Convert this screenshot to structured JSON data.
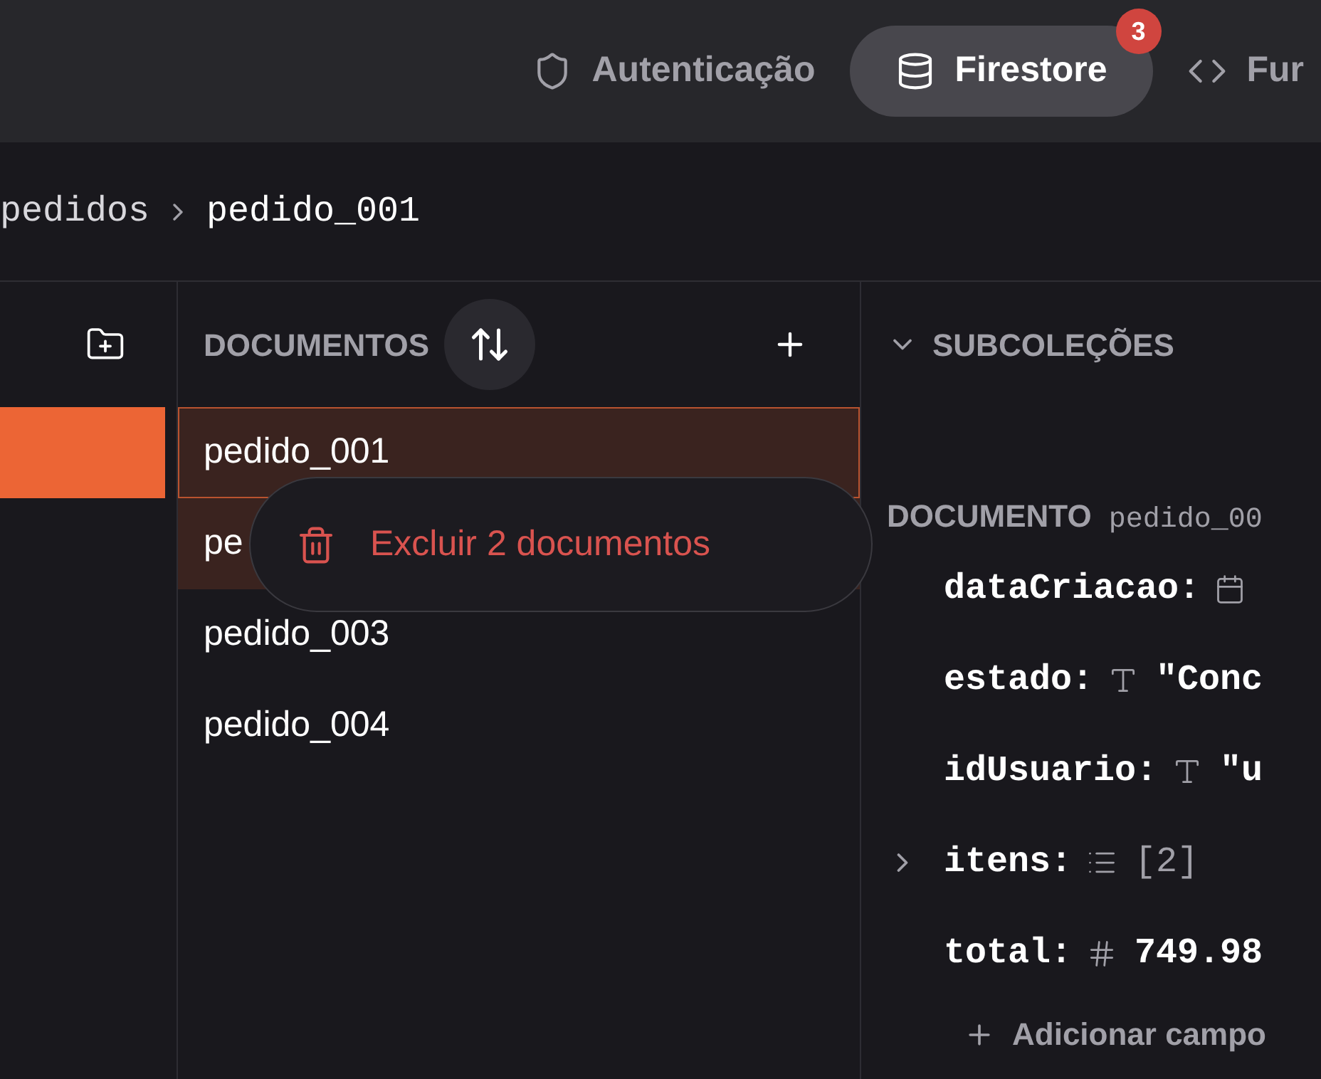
{
  "nav_tabs": [
    {
      "label": "Autenticação",
      "kind": "shield",
      "selected": false
    },
    {
      "label": "Firestore",
      "kind": "database",
      "selected": true,
      "badge": "3"
    },
    {
      "label": "Fur",
      "kind": "code",
      "selected": false
    }
  ],
  "breadcrumb": [
    "pedidos",
    "pedido_001"
  ],
  "documents": {
    "title": "DOCUMENTOS",
    "rows": [
      {
        "label": "pedido_001",
        "selected": true,
        "focused": true
      },
      {
        "label": "pe",
        "selected": true,
        "focused": false
      },
      {
        "label": "pedido_003",
        "selected": false,
        "focused": false
      },
      {
        "label": "pedido_004",
        "selected": false,
        "focused": false
      }
    ]
  },
  "context_menu": {
    "label": "Excluir 2 documentos"
  },
  "subcollections": {
    "title": "SUBCOLEÇÕES",
    "expanded": true
  },
  "document": {
    "title": "DOCUMENTO",
    "id": "pedido_00",
    "fields": [
      {
        "key": "dataCriacao:",
        "kind": "date"
      },
      {
        "key": "estado:",
        "kind": "string",
        "value": "\"Conc"
      },
      {
        "key": "idUsuario:",
        "kind": "string",
        "value": "\"u"
      },
      {
        "key": "itens:",
        "kind": "array",
        "value": "[2]",
        "expanded": false
      },
      {
        "key": "total:",
        "kind": "number",
        "value": "749.98"
      }
    ],
    "add_field": "Adicionar campo"
  }
}
